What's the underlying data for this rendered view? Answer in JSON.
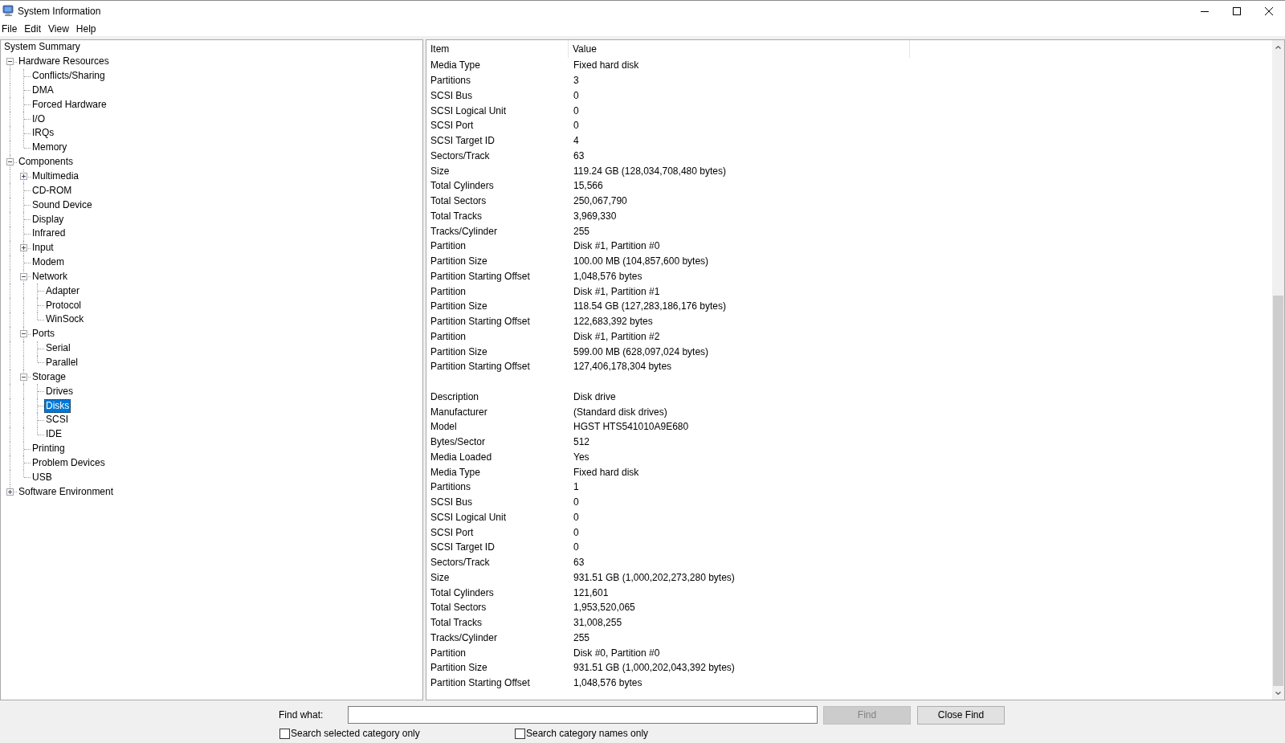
{
  "window": {
    "title": "System Information"
  },
  "menu": [
    "File",
    "Edit",
    "View",
    "Help"
  ],
  "tree": [
    {
      "label": "System Summary",
      "selected": false,
      "children": [
        {
          "label": "Hardware Resources",
          "expanded": true,
          "selected": false,
          "children": [
            {
              "label": "Conflicts/Sharing",
              "selected": false
            },
            {
              "label": "DMA",
              "selected": false
            },
            {
              "label": "Forced Hardware",
              "selected": false
            },
            {
              "label": "I/O",
              "selected": false
            },
            {
              "label": "IRQs",
              "selected": false
            },
            {
              "label": "Memory",
              "selected": false
            }
          ]
        },
        {
          "label": "Components",
          "expanded": true,
          "selected": false,
          "children": [
            {
              "label": "Multimedia",
              "expanded": false,
              "selected": false
            },
            {
              "label": "CD-ROM",
              "selected": false
            },
            {
              "label": "Sound Device",
              "selected": false
            },
            {
              "label": "Display",
              "selected": false
            },
            {
              "label": "Infrared",
              "selected": false
            },
            {
              "label": "Input",
              "expanded": false,
              "selected": false
            },
            {
              "label": "Modem",
              "selected": false
            },
            {
              "label": "Network",
              "expanded": true,
              "selected": false,
              "children": [
                {
                  "label": "Adapter",
                  "selected": false
                },
                {
                  "label": "Protocol",
                  "selected": false
                },
                {
                  "label": "WinSock",
                  "selected": false
                }
              ]
            },
            {
              "label": "Ports",
              "expanded": true,
              "selected": false,
              "children": [
                {
                  "label": "Serial",
                  "selected": false
                },
                {
                  "label": "Parallel",
                  "selected": false
                }
              ]
            },
            {
              "label": "Storage",
              "expanded": true,
              "selected": false,
              "children": [
                {
                  "label": "Drives",
                  "selected": false
                },
                {
                  "label": "Disks",
                  "selected": true
                },
                {
                  "label": "SCSI",
                  "selected": false
                },
                {
                  "label": "IDE",
                  "selected": false
                }
              ]
            },
            {
              "label": "Printing",
              "selected": false
            },
            {
              "label": "Problem Devices",
              "selected": false
            },
            {
              "label": "USB",
              "selected": false
            }
          ]
        },
        {
          "label": "Software Environment",
          "expanded": false,
          "selected": false
        }
      ]
    }
  ],
  "table": {
    "columns": [
      "Item",
      "Value"
    ],
    "groups": [
      {
        "rows": [
          {
            "item": "Media Type",
            "value": "Fixed hard disk"
          },
          {
            "item": "Partitions",
            "value": "3"
          },
          {
            "item": "SCSI Bus",
            "value": "0"
          },
          {
            "item": "SCSI Logical Unit",
            "value": "0"
          },
          {
            "item": "SCSI Port",
            "value": "0"
          },
          {
            "item": "SCSI Target ID",
            "value": "4"
          },
          {
            "item": "Sectors/Track",
            "value": "63"
          },
          {
            "item": "Size",
            "value": "119.24 GB (128,034,708,480 bytes)"
          },
          {
            "item": "Total Cylinders",
            "value": "15,566"
          },
          {
            "item": "Total Sectors",
            "value": "250,067,790"
          },
          {
            "item": "Total Tracks",
            "value": "3,969,330"
          },
          {
            "item": "Tracks/Cylinder",
            "value": "255"
          },
          {
            "item": "Partition",
            "value": "Disk #1, Partition #0"
          },
          {
            "item": "Partition Size",
            "value": "100.00 MB (104,857,600 bytes)"
          },
          {
            "item": "Partition Starting Offset",
            "value": "1,048,576 bytes"
          },
          {
            "item": "Partition",
            "value": "Disk #1, Partition #1"
          },
          {
            "item": "Partition Size",
            "value": "118.54 GB (127,283,186,176 bytes)"
          },
          {
            "item": "Partition Starting Offset",
            "value": "122,683,392 bytes"
          },
          {
            "item": "Partition",
            "value": "Disk #1, Partition #2"
          },
          {
            "item": "Partition Size",
            "value": "599.00 MB (628,097,024 bytes)"
          },
          {
            "item": "Partition Starting Offset",
            "value": "127,406,178,304 bytes"
          }
        ]
      },
      {
        "rows": [
          {
            "item": "Description",
            "value": "Disk drive"
          },
          {
            "item": "Manufacturer",
            "value": "(Standard disk drives)"
          },
          {
            "item": "Model",
            "value": "HGST HTS541010A9E680"
          },
          {
            "item": "Bytes/Sector",
            "value": "512"
          },
          {
            "item": "Media Loaded",
            "value": "Yes"
          },
          {
            "item": "Media Type",
            "value": "Fixed hard disk"
          },
          {
            "item": "Partitions",
            "value": "1"
          },
          {
            "item": "SCSI Bus",
            "value": "0"
          },
          {
            "item": "SCSI Logical Unit",
            "value": "0"
          },
          {
            "item": "SCSI Port",
            "value": "0"
          },
          {
            "item": "SCSI Target ID",
            "value": "0"
          },
          {
            "item": "Sectors/Track",
            "value": "63"
          },
          {
            "item": "Size",
            "value": "931.51 GB (1,000,202,273,280 bytes)"
          },
          {
            "item": "Total Cylinders",
            "value": "121,601"
          },
          {
            "item": "Total Sectors",
            "value": "1,953,520,065"
          },
          {
            "item": "Total Tracks",
            "value": "31,008,255"
          },
          {
            "item": "Tracks/Cylinder",
            "value": "255"
          },
          {
            "item": "Partition",
            "value": "Disk #0, Partition #0"
          },
          {
            "item": "Partition Size",
            "value": "931.51 GB (1,000,202,043,392 bytes)"
          },
          {
            "item": "Partition Starting Offset",
            "value": "1,048,576 bytes"
          }
        ]
      }
    ]
  },
  "find": {
    "label": "Find what:",
    "buttons": [
      {
        "label": "Find",
        "disabled": true
      },
      {
        "label": "Close Find",
        "disabled": false
      }
    ],
    "options": [
      {
        "label": "Search selected category only",
        "checked": false
      },
      {
        "label": "Search category names only",
        "checked": false
      }
    ]
  }
}
